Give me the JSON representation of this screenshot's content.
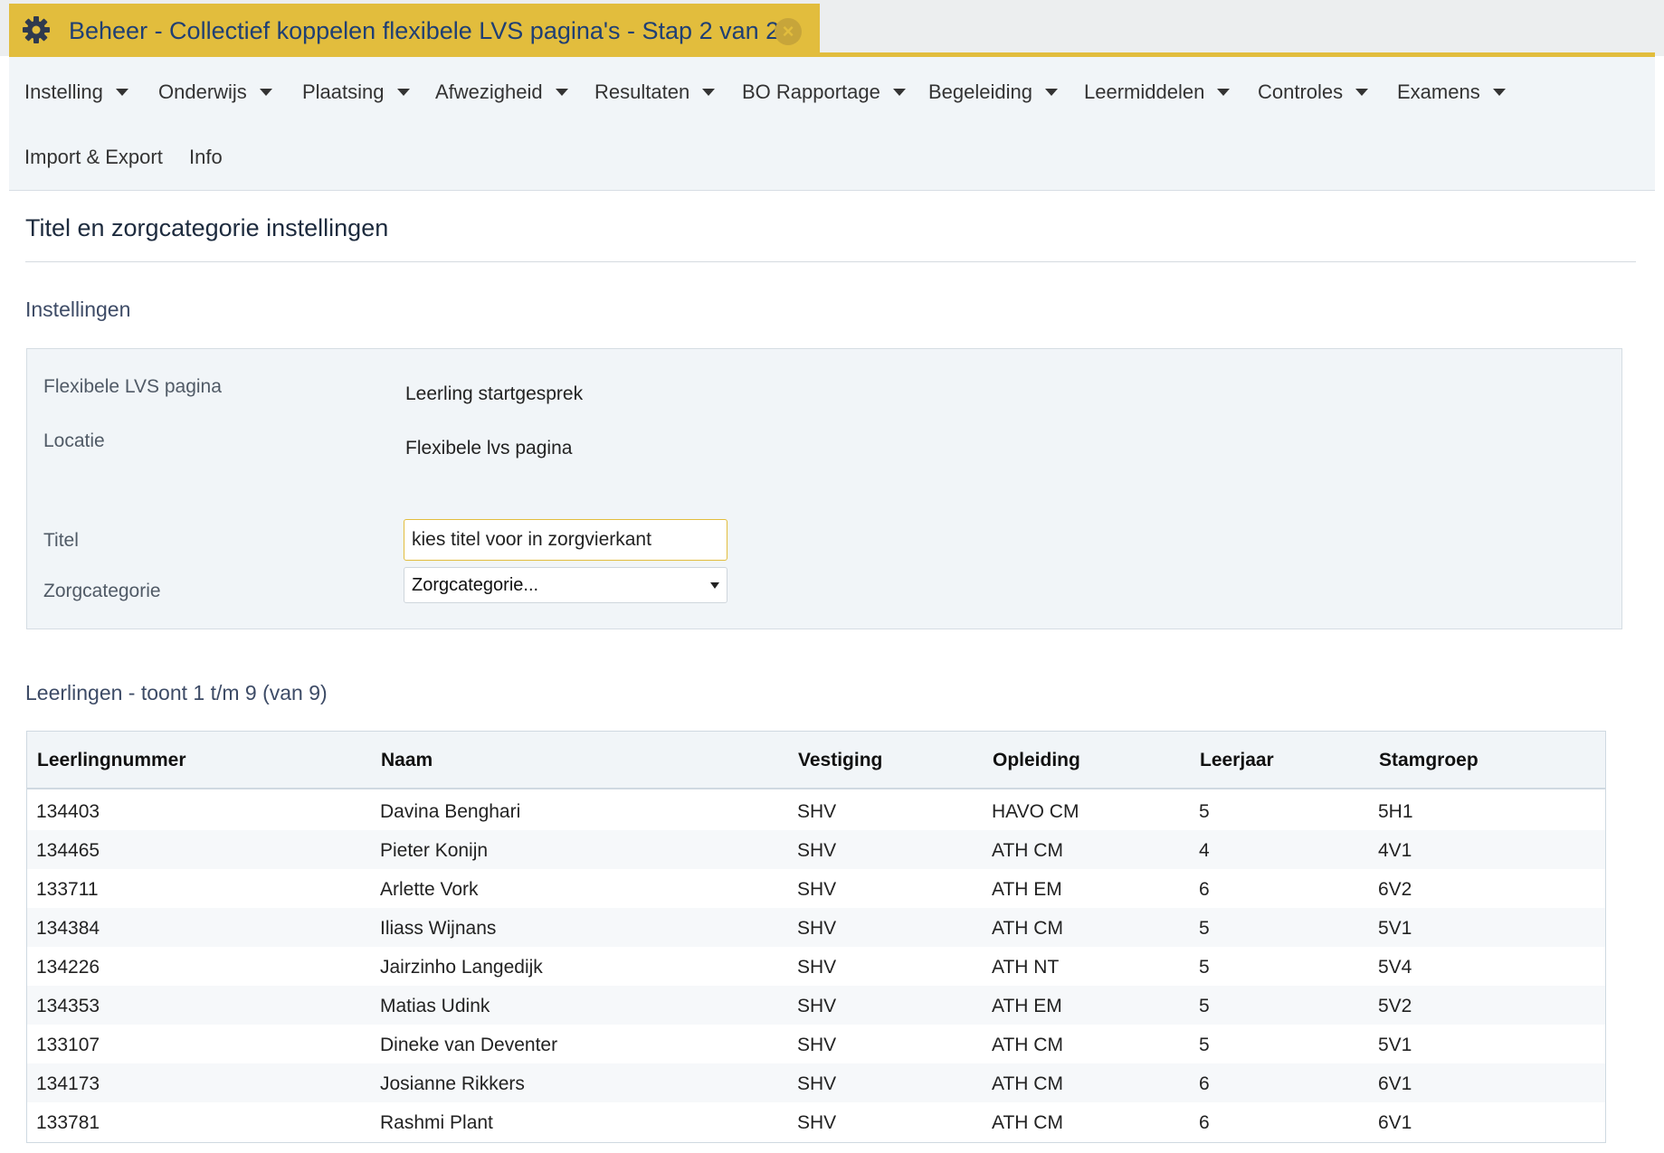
{
  "tab": {
    "title": "Beheer - Collectief koppelen flexibele LVS pagina's - Stap 2 van 2",
    "gear_icon": "gear-icon",
    "close_icon": "close-icon",
    "accent_color": "#e2bd3d"
  },
  "nav": {
    "items": [
      {
        "label": "Instelling",
        "dropdown": true
      },
      {
        "label": "Onderwijs",
        "dropdown": true
      },
      {
        "label": "Plaatsing",
        "dropdown": true
      },
      {
        "label": "Afwezigheid",
        "dropdown": true
      },
      {
        "label": "Resultaten",
        "dropdown": true
      },
      {
        "label": "BO Rapportage",
        "dropdown": true
      },
      {
        "label": "Begeleiding",
        "dropdown": true
      },
      {
        "label": "Leermiddelen",
        "dropdown": true
      },
      {
        "label": "Controles",
        "dropdown": true
      },
      {
        "label": "Examens",
        "dropdown": true
      },
      {
        "label": "Import & Export",
        "dropdown": false
      },
      {
        "label": "Info",
        "dropdown": false
      }
    ]
  },
  "page": {
    "title": "Titel en zorgcategorie instellingen"
  },
  "settings": {
    "section_title": "Instellingen",
    "flex_label": "Flexibele LVS pagina",
    "flex_value": "Leerling startgesprek",
    "locatie_label": "Locatie",
    "locatie_value": "Flexibele lvs pagina",
    "titel_label": "Titel",
    "titel_value": "kies titel voor in zorgvierkant",
    "zorg_label": "Zorgcategorie",
    "zorg_selected": "Zorgcategorie..."
  },
  "students": {
    "section_title": "Leerlingen - toont 1 t/m 9 (van 9)",
    "columns": [
      "Leerlingnummer",
      "Naam",
      "Vestiging",
      "Opleiding",
      "Leerjaar",
      "Stamgroep"
    ],
    "rows": [
      [
        "134403",
        "Davina Benghari",
        "SHV",
        "HAVO CM",
        "5",
        "5H1"
      ],
      [
        "134465",
        "Pieter Konijn",
        "SHV",
        "ATH CM",
        "4",
        "4V1"
      ],
      [
        "133711",
        "Arlette Vork",
        "SHV",
        "ATH EM",
        "6",
        "6V2"
      ],
      [
        "134384",
        "Iliass Wijnans",
        "SHV",
        "ATH CM",
        "5",
        "5V1"
      ],
      [
        "134226",
        "Jairzinho Langedijk",
        "SHV",
        "ATH NT",
        "5",
        "5V4"
      ],
      [
        "134353",
        "Matias Udink",
        "SHV",
        "ATH EM",
        "5",
        "5V2"
      ],
      [
        "133107",
        "Dineke van Deventer",
        "SHV",
        "ATH CM",
        "5",
        "5V1"
      ],
      [
        "134173",
        "Josianne Rikkers",
        "SHV",
        "ATH CM",
        "6",
        "6V1"
      ],
      [
        "133781",
        "Rashmi Plant",
        "SHV",
        "ATH CM",
        "6",
        "6V1"
      ]
    ]
  }
}
